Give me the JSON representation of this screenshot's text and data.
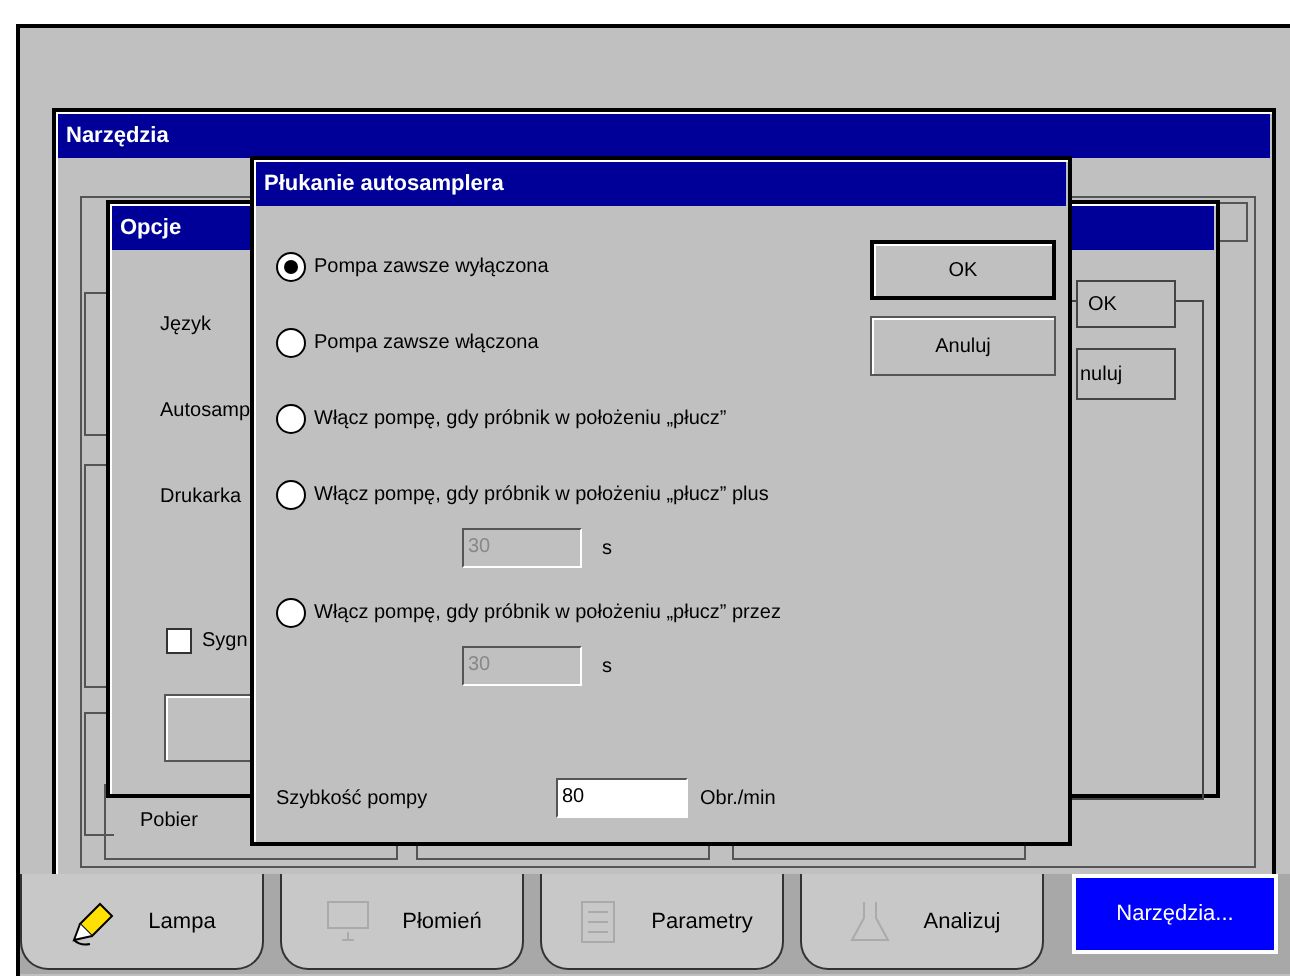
{
  "tools_window": {
    "title": "Narzędzia",
    "group_label": "Pobier"
  },
  "options_window": {
    "title": "Opcje",
    "labels": [
      "Język",
      "Autosamp",
      "Drukarka"
    ],
    "checkbox": {
      "label": "Sygn",
      "checked": false
    },
    "buttons": [
      "OK",
      "nuluj"
    ]
  },
  "rinse_dialog": {
    "title": "Płukanie autosamplera",
    "options": [
      {
        "label": "Pompa zawsze wyłączona",
        "selected": true
      },
      {
        "label": "Pompa zawsze włączona",
        "selected": false
      },
      {
        "label": "Włącz pompę, gdy próbnik w położeniu „płucz”",
        "selected": false
      },
      {
        "label": "Włącz pompę, gdy próbnik w położeniu „płucz” plus",
        "selected": false,
        "duration": {
          "value": "30",
          "unit": "s",
          "disabled": true
        }
      },
      {
        "label": "Włącz pompę, gdy próbnik w położeniu „płucz” przez",
        "selected": false,
        "duration": {
          "value": "30",
          "unit": "s",
          "disabled": true
        }
      }
    ],
    "pump_speed": {
      "label": "Szybkość pompy",
      "value": "80",
      "unit": "Obr./min"
    },
    "buttons": [
      {
        "label": "OK",
        "default": true
      },
      {
        "label": "Anuluj",
        "default": false
      }
    ]
  },
  "tabs": [
    {
      "label": "Lampa",
      "selected": false
    },
    {
      "label": "Płomień",
      "selected": false
    },
    {
      "label": "Parametry",
      "selected": false
    },
    {
      "label": "Analizuj",
      "selected": false
    },
    {
      "label": "Narzędzia...",
      "selected": true
    }
  ]
}
